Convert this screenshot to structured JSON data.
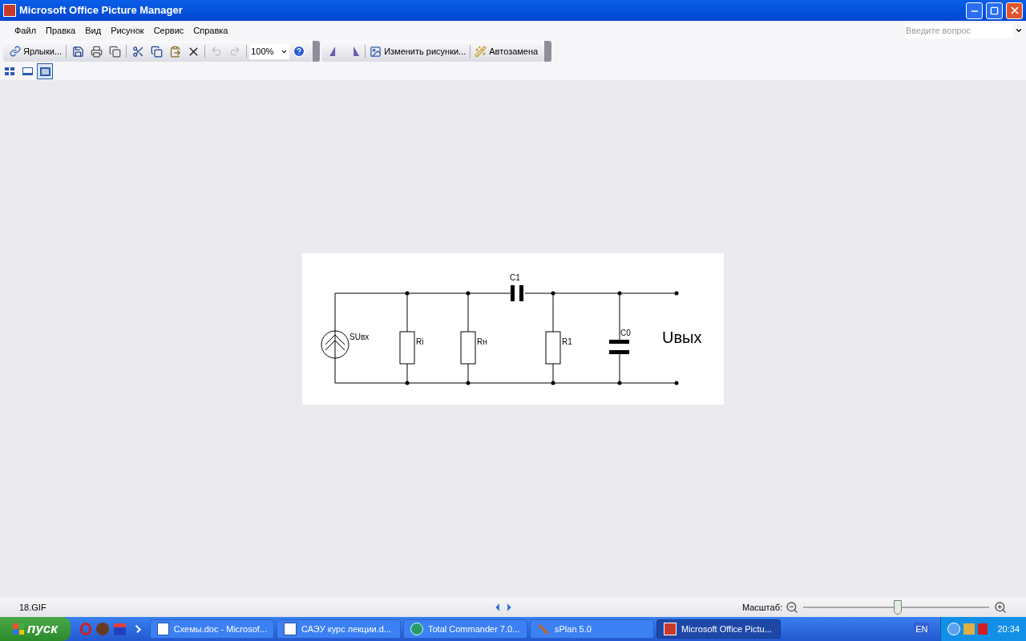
{
  "window": {
    "title": "Microsoft Office Picture Manager"
  },
  "menu": [
    "Файл",
    "Правка",
    "Вид",
    "Рисунок",
    "Сервис",
    "Справка"
  ],
  "help_box": {
    "placeholder": "Введите вопрос"
  },
  "toolbar": {
    "shortcuts_button": "Ярлыки...",
    "zoom_value": "100%",
    "edit_button": "Изменить рисунки...",
    "autofix_button": "Автозамена"
  },
  "view_buttons": [
    {
      "kind": "thumbnails",
      "selected": false
    },
    {
      "kind": "filmstrip",
      "selected": false
    },
    {
      "kind": "single",
      "selected": true
    }
  ],
  "picture": {
    "labels": {
      "c1": "C1",
      "source": "SUвх",
      "ri": "Ri",
      "rn": "Rн",
      "r1": "R1",
      "c0": "C0",
      "output": "Uвых"
    }
  },
  "status_bar": {
    "file_name": "18.GIF",
    "zoom_label": "Масштаб:",
    "zoom_slider": {
      "level": 0.51
    }
  },
  "taskbar": {
    "start": "пуск",
    "tasks": [
      {
        "kind": "word",
        "label": "Схемы.doc - Microsof...",
        "selected": false
      },
      {
        "kind": "word",
        "label": "САЭУ курс лекции.d...",
        "selected": false
      },
      {
        "kind": "commander",
        "label": "Total Commander 7.0...",
        "selected": false
      },
      {
        "kind": "splan",
        "label": "sPlan 5.0",
        "selected": false
      },
      {
        "kind": "picture",
        "label": "Microsoft Office Pictu...",
        "selected": true
      }
    ],
    "language": "EN",
    "clock": "20:34"
  }
}
